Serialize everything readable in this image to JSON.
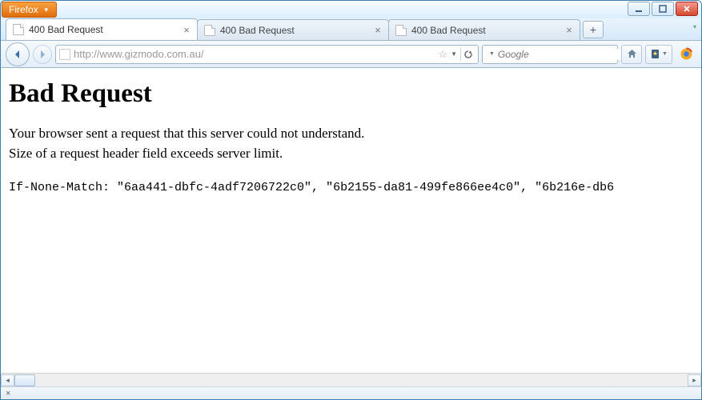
{
  "app": {
    "menu_label": "Firefox"
  },
  "window_controls": {
    "min": "minimize",
    "max": "maximize",
    "close": "close"
  },
  "tabs": [
    {
      "title": "400 Bad Request",
      "active": true
    },
    {
      "title": "400 Bad Request",
      "active": false
    },
    {
      "title": "400 Bad Request",
      "active": false
    }
  ],
  "newtab_label": "+",
  "nav": {
    "url": "http://www.gizmodo.com.au/",
    "search_placeholder": "Google"
  },
  "page": {
    "heading": "Bad Request",
    "line1": "Your browser sent a request that this server could not understand.",
    "line2": "Size of a request header field exceeds server limit.",
    "raw_header": "If-None-Match: \"6aa441-dbfc-4adf7206722c0\", \"6b2155-da81-499fe866ee4c0\", \"6b216e-db6"
  },
  "status": {
    "close_glyph": "×"
  }
}
